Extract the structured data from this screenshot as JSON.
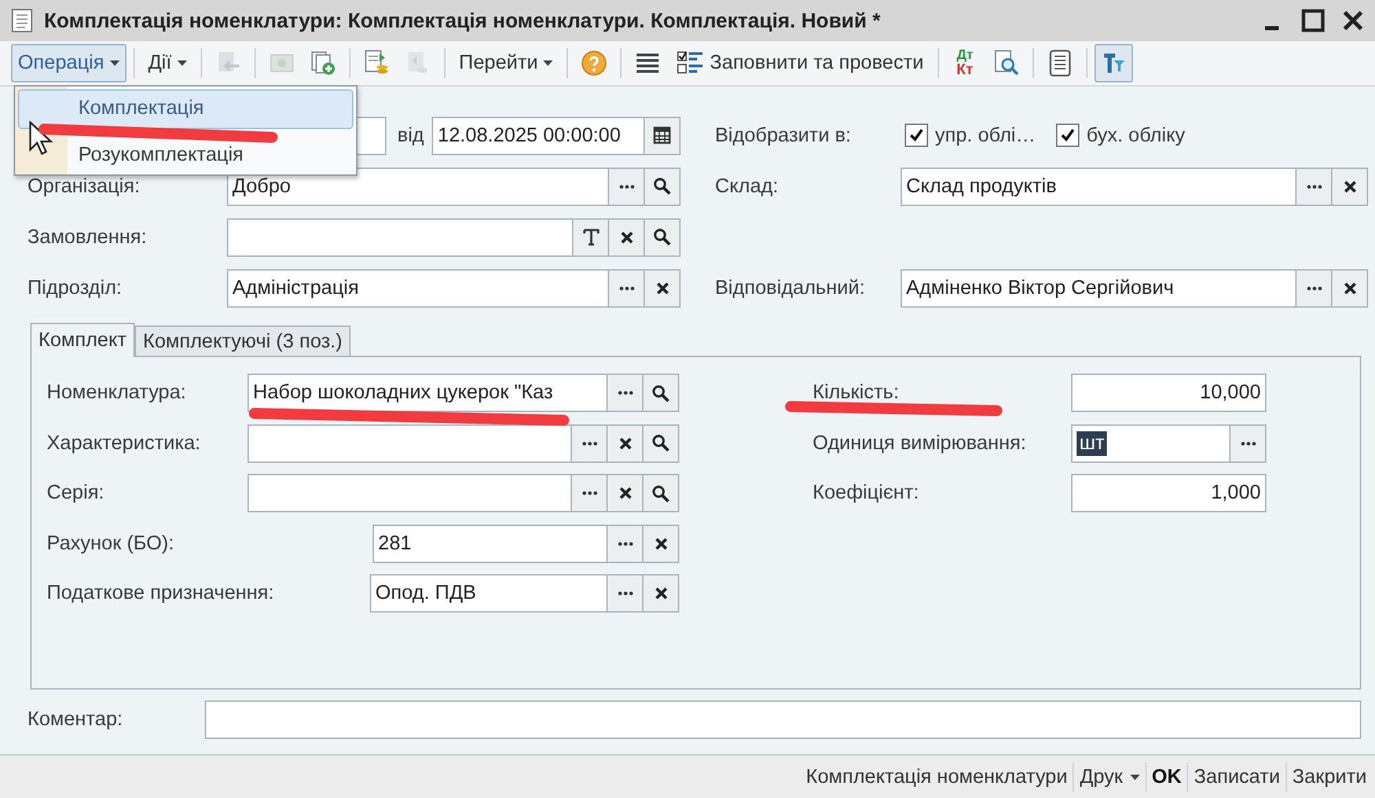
{
  "window": {
    "title": "Комплектація номенклатури: Комплектація номенклатури. Комплектація. Новий *"
  },
  "toolbar": [
    {
      "kind": "menu",
      "label": "Операція",
      "pressed": true
    },
    {
      "kind": "separator"
    },
    {
      "kind": "menu",
      "label": "Дії",
      "pressed": false
    },
    {
      "kind": "separator"
    },
    {
      "kind": "icon",
      "disabled": true,
      "pressed": false
    },
    {
      "kind": "separator"
    },
    {
      "kind": "icon",
      "disabled": true,
      "pressed": false
    },
    {
      "kind": "icon",
      "disabled": false,
      "pressed": false
    },
    {
      "kind": "separator"
    },
    {
      "kind": "icon",
      "disabled": false,
      "pressed": false
    },
    {
      "kind": "icon",
      "disabled": true,
      "pressed": false
    },
    {
      "kind": "separator"
    },
    {
      "kind": "menu",
      "label": "Перейти",
      "pressed": false
    },
    {
      "kind": "separator"
    },
    {
      "kind": "icon",
      "disabled": false,
      "pressed": false
    },
    {
      "kind": "separator"
    },
    {
      "kind": "icon",
      "disabled": false,
      "pressed": false
    },
    {
      "kind": "button",
      "label": "Заповнити та провести",
      "pressed": false
    },
    {
      "kind": "separator"
    },
    {
      "kind": "ledger",
      "top": "Дт",
      "bottom": "Кт",
      "pressed": false
    },
    {
      "kind": "icon",
      "disabled": false,
      "pressed": false
    },
    {
      "kind": "separator"
    },
    {
      "kind": "icon",
      "disabled": false,
      "pressed": false
    },
    {
      "kind": "separator"
    },
    {
      "kind": "icon",
      "disabled": false,
      "pressed": true
    }
  ],
  "operation_menu": [
    {
      "label": "Комплектація",
      "selected": true
    },
    {
      "label": "Розукомплектація",
      "selected": false
    }
  ],
  "header": {
    "number": {
      "date_label": "від",
      "date": "12.08.2025 00:00:00"
    },
    "left_fields": [
      {
        "label": "Організація:",
        "value": "Добро",
        "buttons": [
          {
            "kind": "choose"
          },
          {
            "kind": "search"
          }
        ]
      },
      {
        "label": "Замовлення:",
        "buttons": [
          {
            "kind": "type"
          },
          {
            "kind": "clear"
          },
          {
            "kind": "search"
          }
        ]
      },
      {
        "label": "Підрозділ:",
        "value": "Адміністрація",
        "buttons": [
          {
            "kind": "choose"
          },
          {
            "kind": "clear"
          }
        ]
      }
    ],
    "show_in": {
      "label": "Відобразити в:",
      "options": [
        {
          "label": "упр. облі…",
          "checked": true
        },
        {
          "label": "бух. обліку",
          "checked": true
        }
      ]
    },
    "right_fields": [
      {
        "label": "Склад:",
        "value": "Склад продуктів",
        "buttons": [
          {
            "kind": "choose"
          },
          {
            "kind": "clear"
          }
        ]
      },
      {
        "label": "Відповідальний:",
        "value": "Адміненко Віктор Сергійович",
        "buttons": [
          {
            "kind": "choose"
          },
          {
            "kind": "clear"
          }
        ]
      }
    ]
  },
  "tabs": [
    {
      "label": "Комплект",
      "selected": true
    },
    {
      "label": "Комплектуючі (3 поз.)",
      "selected": false
    }
  ],
  "set_fields": [
    {
      "label": "Номенклатура:",
      "value": "Набор шоколадних цукерок \"Каз",
      "buttons": [
        {
          "kind": "choose"
        },
        {
          "kind": "search"
        }
      ]
    },
    {
      "label": "Характеристика:",
      "buttons": [
        {
          "kind": "choose"
        },
        {
          "kind": "clear"
        },
        {
          "kind": "search"
        }
      ]
    },
    {
      "label": "Серія:",
      "buttons": [
        {
          "kind": "choose"
        },
        {
          "kind": "clear"
        },
        {
          "kind": "search"
        }
      ]
    },
    {
      "label": "Рахунок (БО):",
      "value": "281",
      "buttons": [
        {
          "kind": "choose"
        },
        {
          "kind": "clear"
        }
      ]
    },
    {
      "label": "Податкове призначення:",
      "value": "Опод. ПДВ",
      "buttons": [
        {
          "kind": "choose"
        },
        {
          "kind": "clear"
        }
      ]
    }
  ],
  "quantity_fields": [
    {
      "label": "Кількість:",
      "value": "10,000",
      "numeric": true
    },
    {
      "label": "Одиниця вимірювання:",
      "value": "шт",
      "numeric": false,
      "text_selected": true,
      "buttons": [
        {
          "kind": "choose"
        }
      ]
    },
    {
      "label": "Коефіцієнт:",
      "value": "1,000",
      "numeric": true
    }
  ],
  "comment": {
    "label": "Коментар:"
  },
  "footer_buttons": [
    {
      "label": "Комплектація номенклатури",
      "kind": "plain"
    },
    {
      "label": "Друк",
      "kind": "menu"
    },
    {
      "label": "OK",
      "kind": "default"
    },
    {
      "label": "Записати",
      "kind": "plain"
    },
    {
      "label": "Закрити",
      "kind": "plain"
    }
  ],
  "annotation_marks": [
    {
      "color": "#f23b3f"
    },
    {
      "color": "#f23b3f"
    },
    {
      "color": "#f23b3f"
    }
  ]
}
